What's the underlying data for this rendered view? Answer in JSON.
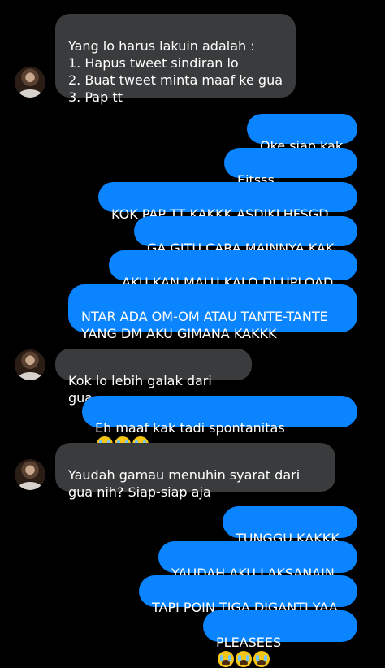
{
  "messages": [
    {
      "id": "m1",
      "sender": "other",
      "text": "Yang lo harus lakuin adalah :\n1. Hapus tweet sindiran lo\n2. Buat tweet minta maaf ke gua\n3. Pap tt"
    },
    {
      "id": "m2",
      "sender": "me",
      "text": "Oke siap kak"
    },
    {
      "id": "m3",
      "sender": "me",
      "text": "Eitsss bentar......"
    },
    {
      "id": "m4",
      "sender": "me",
      "text": "KOK PAP TT KAKKK ASDJKLHFSGD"
    },
    {
      "id": "m5",
      "sender": "me",
      "text": "GA GITU CARA MAINNYA KAK"
    },
    {
      "id": "m6",
      "sender": "me",
      "text": "AKU KAN MALU KALO DI UPLOAD"
    },
    {
      "id": "m7",
      "sender": "me",
      "text": "NTAR ADA OM-OM ATAU TANTE-TANTE\nYANG DM AKU GIMANA KAKKK"
    },
    {
      "id": "m8",
      "sender": "other",
      "text": "Kok lo lebih galak dari gua"
    },
    {
      "id": "m9",
      "sender": "me",
      "text": "Eh maaf kak tadi spontanitas",
      "emoji": [
        "loudly-crying-face",
        "loudly-crying-face",
        "loudly-crying-face"
      ]
    },
    {
      "id": "m10",
      "sender": "other",
      "text": "Yaudah gamau menuhin syarat dari\ngua nih? Siap-siap aja"
    },
    {
      "id": "m11",
      "sender": "me",
      "text": "TUNGGU KAKKK"
    },
    {
      "id": "m12",
      "sender": "me",
      "text": "YAUDAH AKU LAKSANAIN"
    },
    {
      "id": "m13",
      "sender": "me",
      "text": "TAPI POIN TIGA DIGANTI YAA"
    },
    {
      "id": "m14",
      "sender": "me",
      "text": "PLEASEES",
      "emoji": [
        "loudly-crying-face",
        "loudly-crying-face",
        "loudly-crying-face"
      ]
    }
  ],
  "colors": {
    "background": "#000000",
    "received_bubble": "#3a3b3c",
    "sent_bubble": "#0a84ff",
    "text": "#ffffff"
  }
}
